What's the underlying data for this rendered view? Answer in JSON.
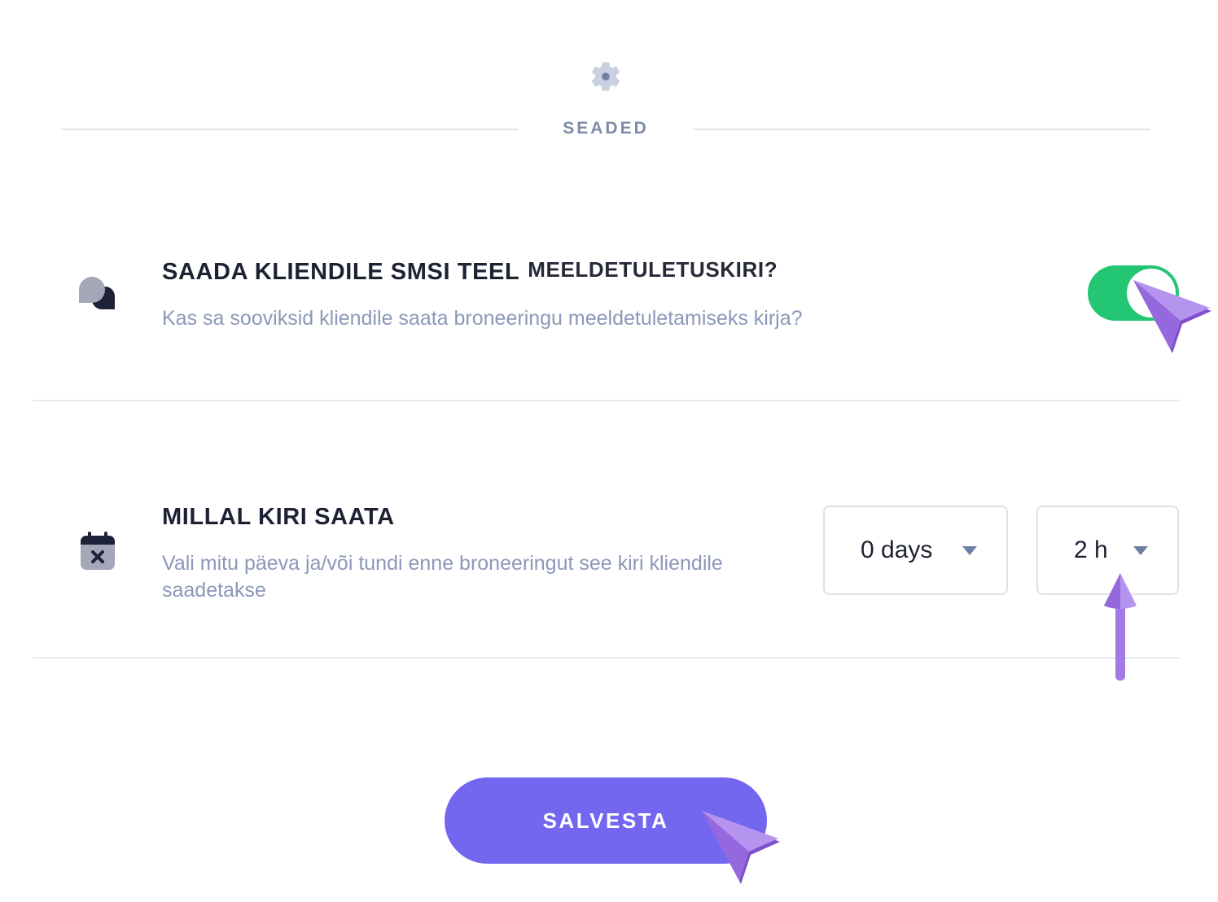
{
  "header": {
    "icon": "gear-icon",
    "title": "SEADED"
  },
  "sms_reminder": {
    "icon": "chat-bubbles-icon",
    "title_part1": "SAADA KLIENDILE SMSI TEEL",
    "title_part2": "MEELDETULETUSKIRI?",
    "description": "Kas sa sooviksid kliendile saata broneeringu meeldetuletamiseks kirja?",
    "enabled": true
  },
  "send_time": {
    "icon": "calendar-x-icon",
    "title": "MILLAL KIRI SAATA",
    "description": "Vali mitu päeva ja/või tundi enne broneeringut see kiri kliendile saadetakse",
    "days_value": "0 days",
    "hours_value": "2 h"
  },
  "save_button": {
    "label": "SALVESTA"
  },
  "colors": {
    "toggle_on": "#23c672",
    "primary_button": "#7367f0",
    "pointer": "#a27be6",
    "muted_text": "#8c98b8"
  }
}
